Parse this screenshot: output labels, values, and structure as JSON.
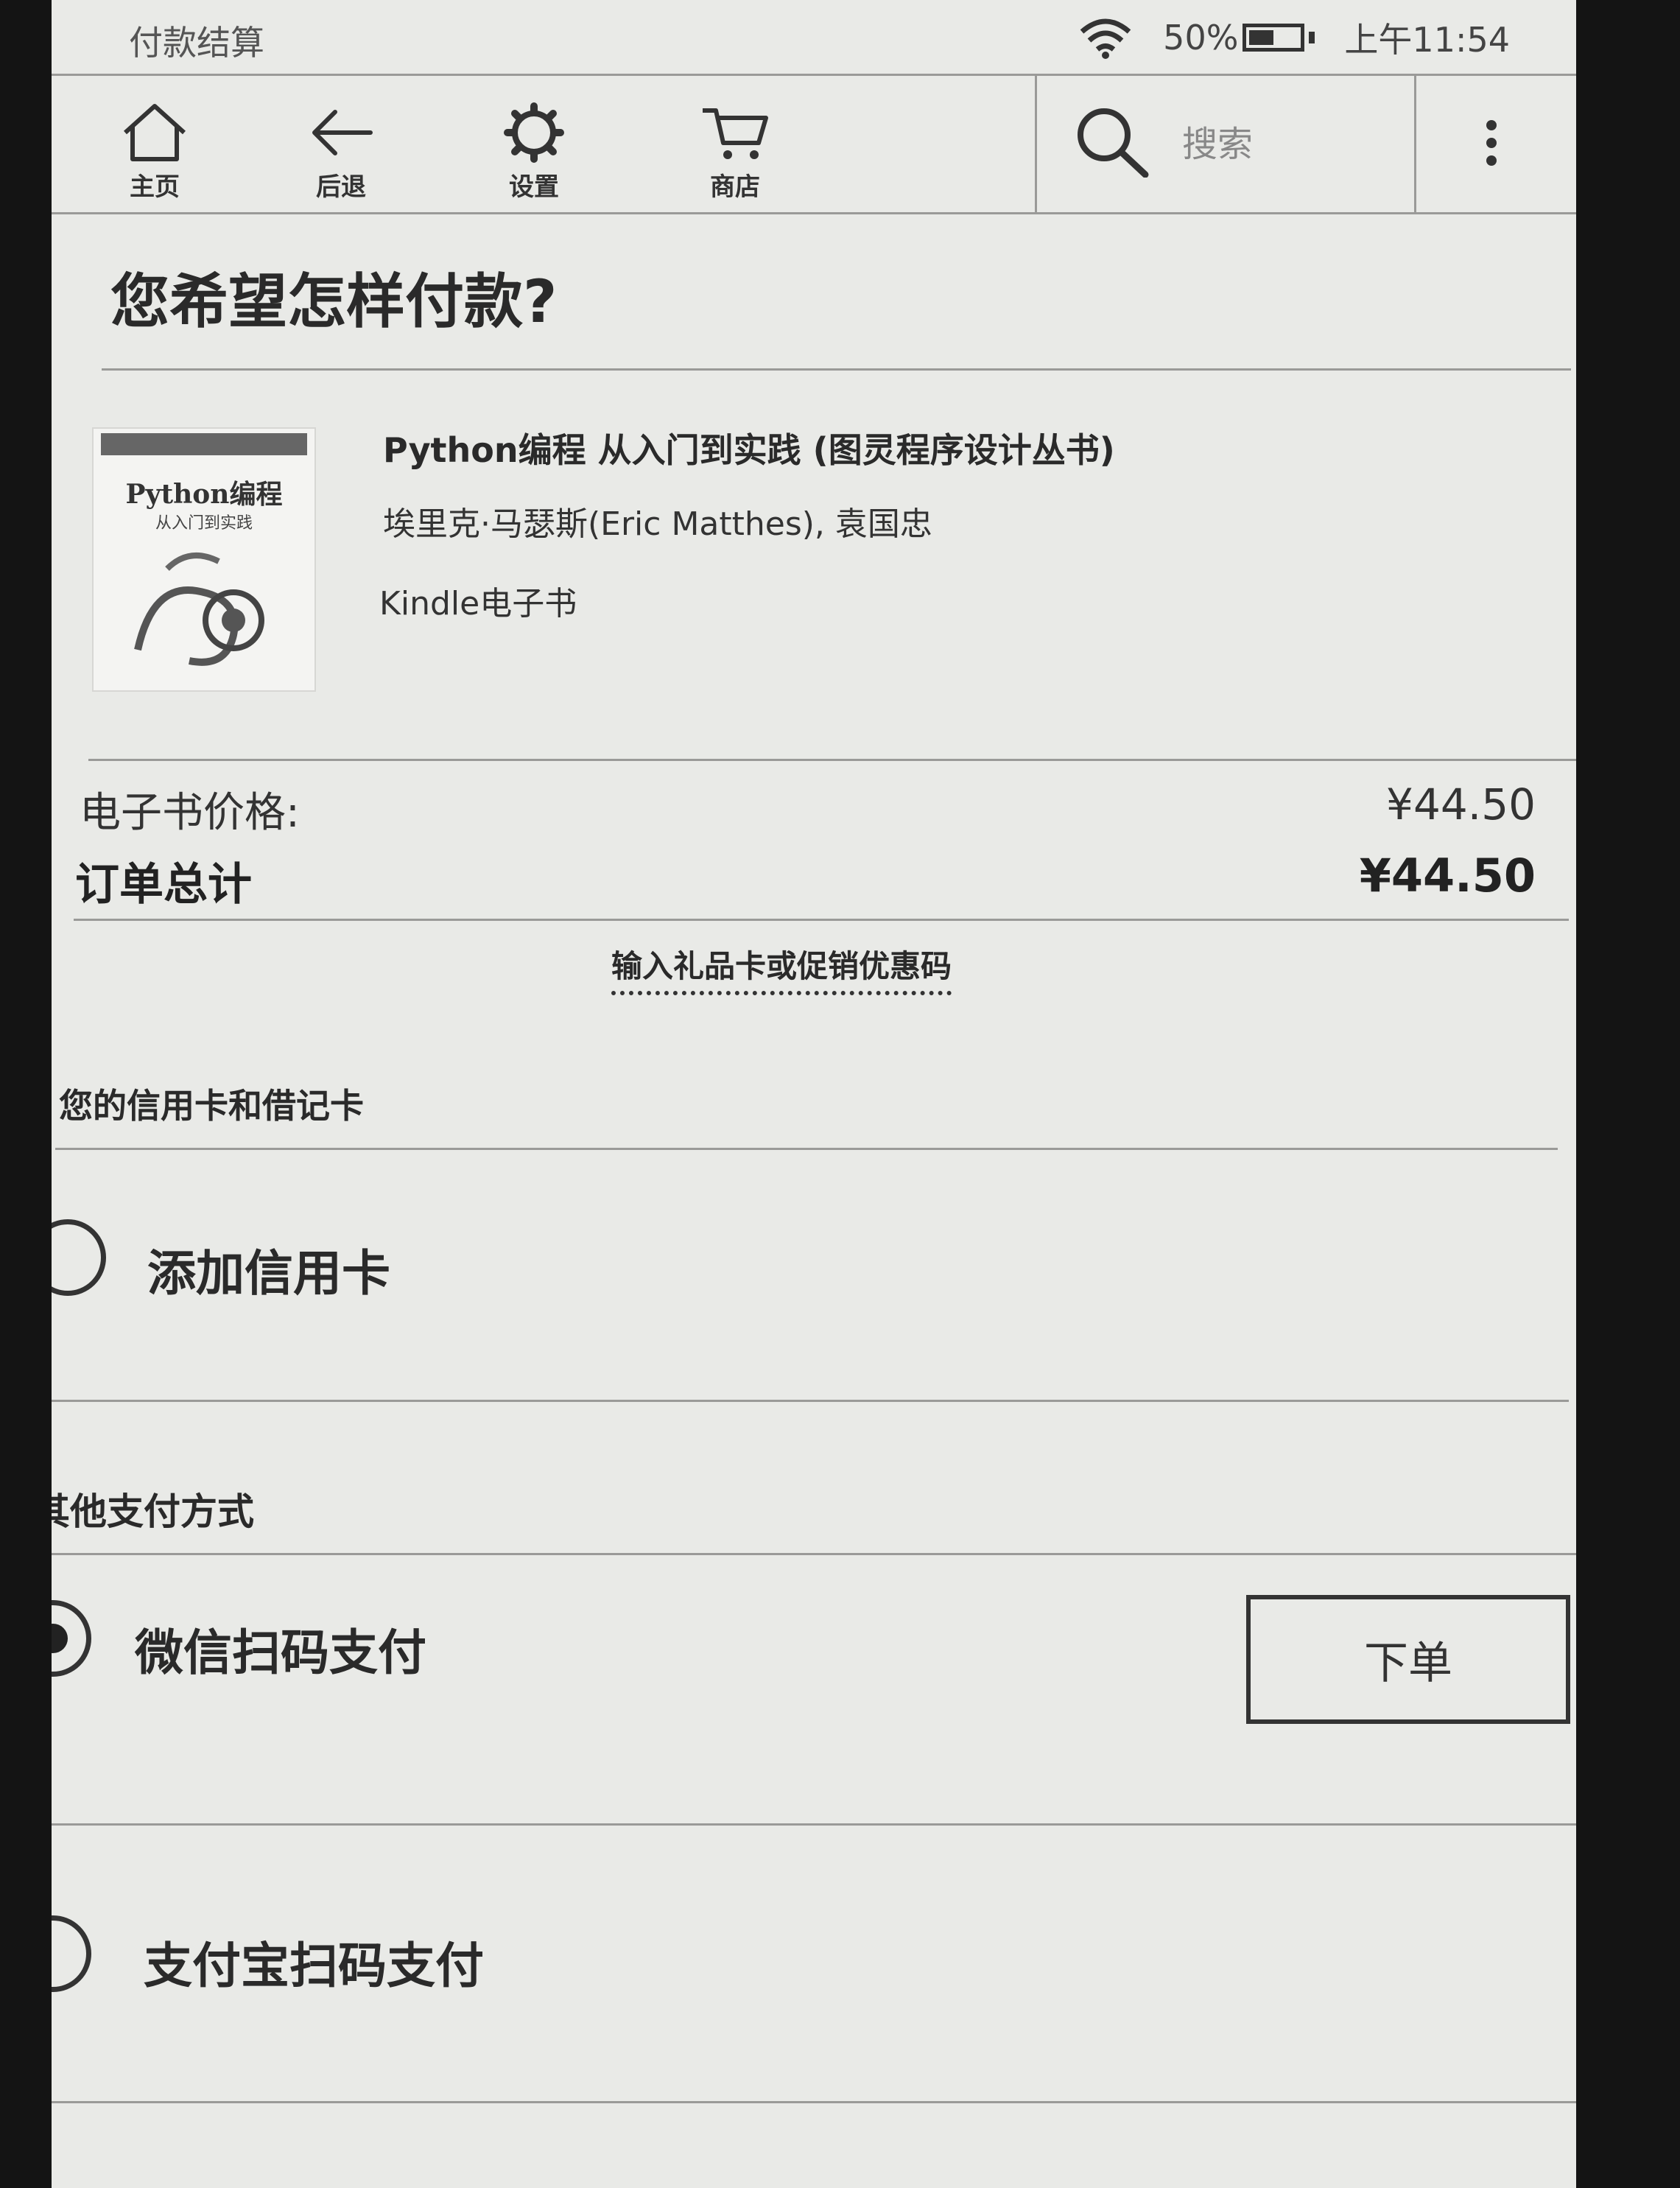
{
  "status_bar": {
    "title": "付款结算",
    "battery": "50%",
    "battery_level": 0.5,
    "time": "上午11:54"
  },
  "toolbar": {
    "home_label": "主页",
    "back_label": "后退",
    "settings_label": "设置",
    "store_label": "商店",
    "search_placeholder": "搜索"
  },
  "page": {
    "heading": "您希望怎样付款?"
  },
  "book": {
    "title": "Python编程 从入门到实践 (图灵程序设计丛书)",
    "author": "埃里克·马瑟斯(Eric Matthes), 袁国忠",
    "format": "Kindle电子书",
    "cover_title": "Python编程",
    "cover_subtitle": "从入门到实践"
  },
  "summary": {
    "price_label": "电子书价格:",
    "price_value": "¥44.50",
    "total_label": "订单总计",
    "total_value": "¥44.50",
    "gift_link": "输入礼品卡或促销优惠码"
  },
  "cards_section": {
    "heading": "您的信用卡和借记卡",
    "add_card_label": "添加信用卡"
  },
  "other_section": {
    "heading": "其他支付方式",
    "wechat_label": "微信扫码支付",
    "alipay_label": "支付宝扫码支付",
    "selected": "wechat",
    "order_button": "下单"
  }
}
